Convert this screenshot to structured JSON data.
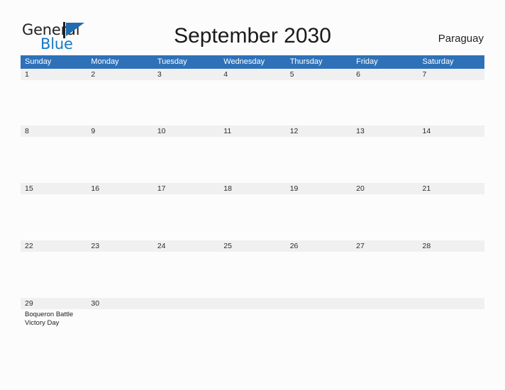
{
  "brand": {
    "name_part1": "General",
    "name_part2": "Blue",
    "flag_icon": "triangle-flag-icon",
    "accent_color": "#1f6cb0",
    "blue_text_color": "#1279c6"
  },
  "header": {
    "title": "September 2030",
    "country": "Paraguay"
  },
  "theme": {
    "header_blue": "#2e71b8",
    "date_band_gray": "#f0f0f0",
    "page_background": "#fcfcfc",
    "text_color": "#1a1a1a"
  },
  "calendar": {
    "month": "September",
    "year": "2030",
    "weekdays": [
      "Sunday",
      "Monday",
      "Tuesday",
      "Wednesday",
      "Thursday",
      "Friday",
      "Saturday"
    ],
    "weeks": [
      [
        {
          "date": "1",
          "events": []
        },
        {
          "date": "2",
          "events": []
        },
        {
          "date": "3",
          "events": []
        },
        {
          "date": "4",
          "events": []
        },
        {
          "date": "5",
          "events": []
        },
        {
          "date": "6",
          "events": []
        },
        {
          "date": "7",
          "events": []
        }
      ],
      [
        {
          "date": "8",
          "events": []
        },
        {
          "date": "9",
          "events": []
        },
        {
          "date": "10",
          "events": []
        },
        {
          "date": "11",
          "events": []
        },
        {
          "date": "12",
          "events": []
        },
        {
          "date": "13",
          "events": []
        },
        {
          "date": "14",
          "events": []
        }
      ],
      [
        {
          "date": "15",
          "events": []
        },
        {
          "date": "16",
          "events": []
        },
        {
          "date": "17",
          "events": []
        },
        {
          "date": "18",
          "events": []
        },
        {
          "date": "19",
          "events": []
        },
        {
          "date": "20",
          "events": []
        },
        {
          "date": "21",
          "events": []
        }
      ],
      [
        {
          "date": "22",
          "events": []
        },
        {
          "date": "23",
          "events": []
        },
        {
          "date": "24",
          "events": []
        },
        {
          "date": "25",
          "events": []
        },
        {
          "date": "26",
          "events": []
        },
        {
          "date": "27",
          "events": []
        },
        {
          "date": "28",
          "events": []
        }
      ],
      [
        {
          "date": "29",
          "events": [
            "Boqueron Battle Victory Day"
          ]
        },
        {
          "date": "30",
          "events": []
        },
        {
          "date": "",
          "events": []
        },
        {
          "date": "",
          "events": []
        },
        {
          "date": "",
          "events": []
        },
        {
          "date": "",
          "events": []
        },
        {
          "date": "",
          "events": []
        }
      ]
    ]
  }
}
